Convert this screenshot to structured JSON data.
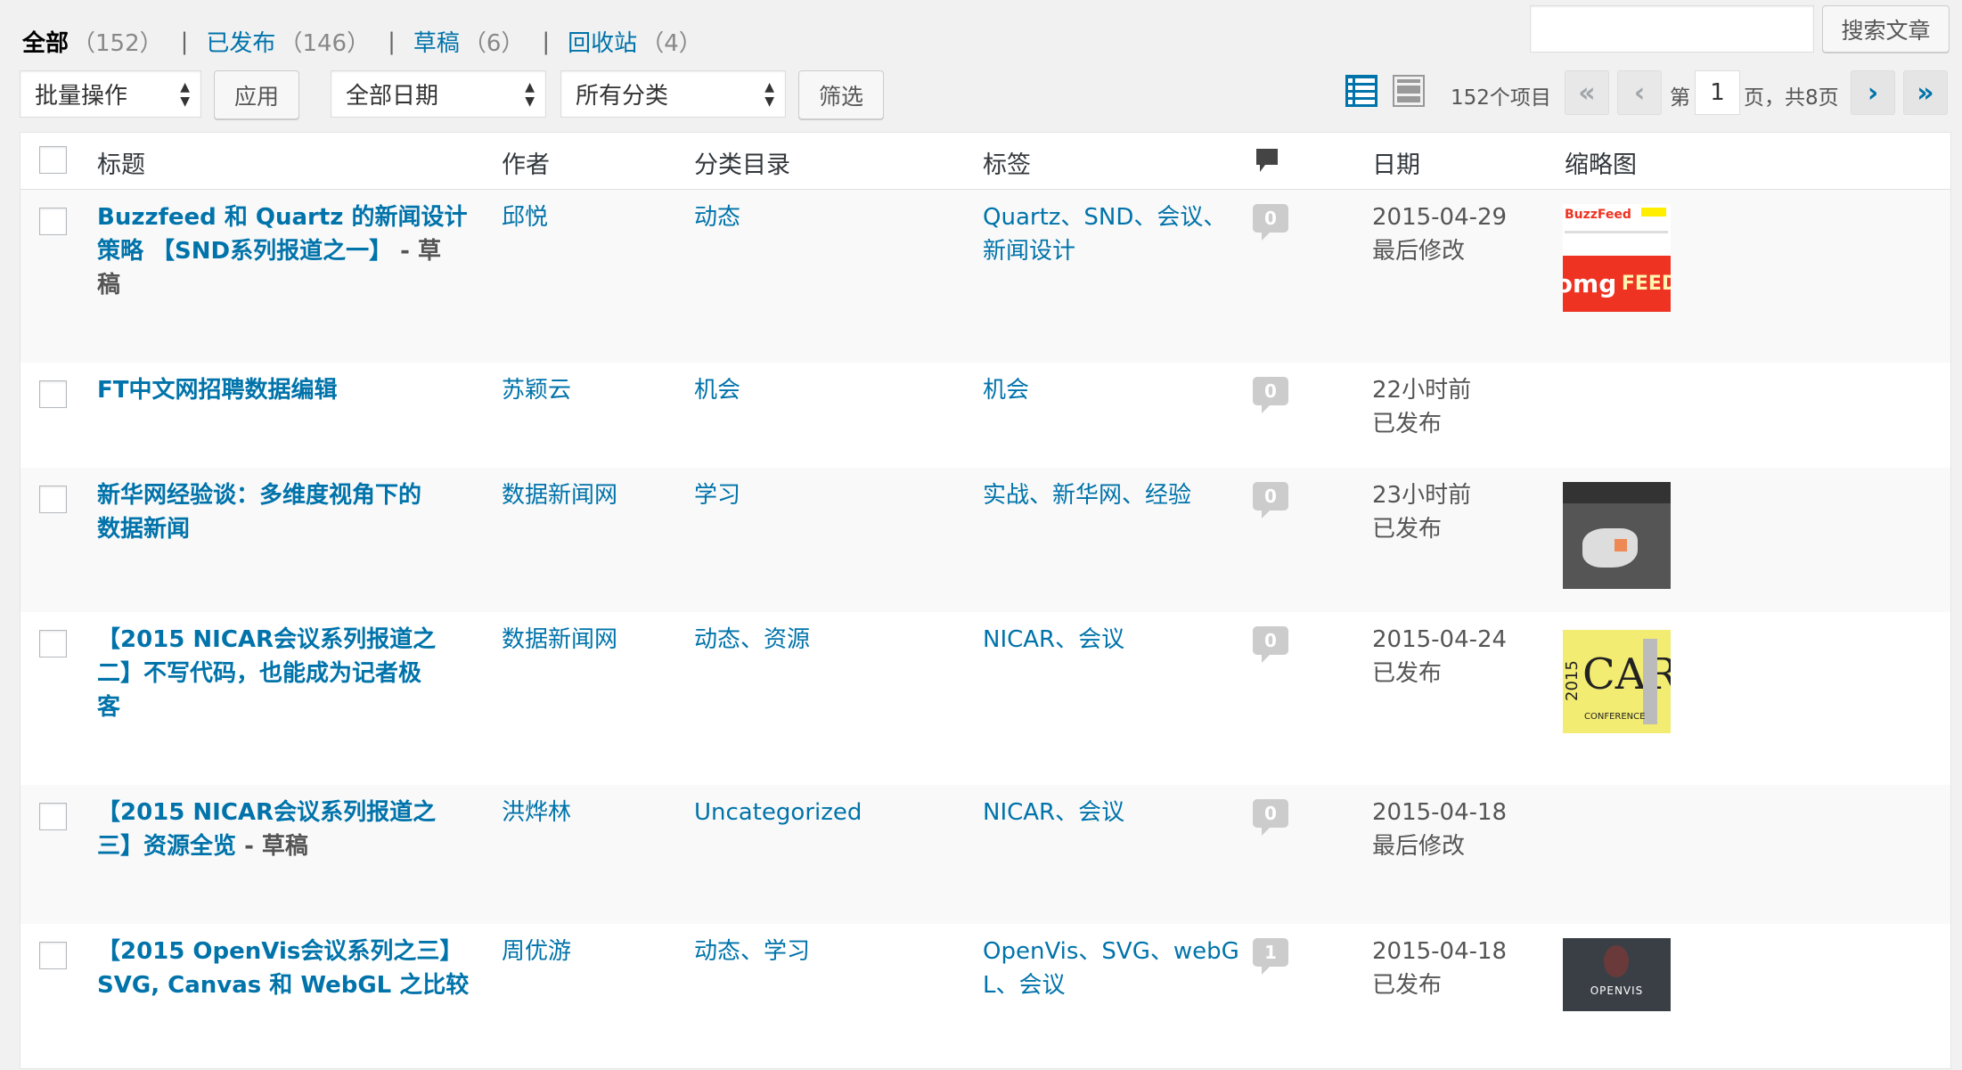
{
  "filters": {
    "all": {
      "label": "全部",
      "count": "（152）"
    },
    "published": {
      "label": "已发布",
      "count": "（146）"
    },
    "drafts": {
      "label": "草稿",
      "count": "（6）"
    },
    "trash": {
      "label": "回收站",
      "count": "（4）"
    },
    "separator": "|"
  },
  "search": {
    "input_value": "",
    "button_label": "搜索文章"
  },
  "tablenav": {
    "bulk_actions": "批量操作",
    "apply_label": "应用",
    "dates": "全部日期",
    "categories": "所有分类",
    "filter_label": "筛选",
    "items_count": "152个项目",
    "first_page": "«",
    "prev_page": "‹",
    "page_prefix": "第",
    "current_page": "1",
    "page_suffix": "页，共8页",
    "next_page": "›",
    "last_page": "»"
  },
  "columns": {
    "title": "标题",
    "author": "作者",
    "categories": "分类目录",
    "tags": "标签",
    "comments_icon": "comment-icon",
    "date": "日期",
    "thumbnail": "缩略图"
  },
  "posts": [
    {
      "title_lines": [
        "Buzzfeed 和 Quartz 的新闻设计",
        "策略 【SND系列报道之一】"
      ],
      "title_state": " - 草",
      "title_state_line2": "稿",
      "author": "邱悦",
      "categories": "动态",
      "tags_lines": [
        "Quartz、SND、会议、",
        "新闻设计"
      ],
      "comments": "0",
      "date": "2015-04-29",
      "status": "最后修改",
      "thumb": {
        "brand": "BuzzFeed",
        "text1": "omg",
        "text2": "FEED"
      }
    },
    {
      "title_lines": [
        "FT中文网招聘数据编辑"
      ],
      "author": "苏颖云",
      "categories": "机会",
      "tags_lines": [
        "机会"
      ],
      "comments": "0",
      "date": "22小时前",
      "status": "已发布"
    },
    {
      "title_lines": [
        "新华网经验谈：多维度视角下的",
        "数据新闻"
      ],
      "author": "数据新闻网",
      "categories": "学习",
      "tags_lines": [
        "实战、新华网、经验"
      ],
      "comments": "0",
      "date": "23小时前",
      "status": "已发布",
      "thumb": {}
    },
    {
      "title_lines": [
        "【2015 NICAR会议系列报道之",
        "二】不写代码，也能成为记者极",
        "客"
      ],
      "author": "数据新闻网",
      "categories": "动态、资源",
      "tags_lines": [
        "NICAR、会议"
      ],
      "comments": "0",
      "date": "2015-04-24",
      "status": "已发布",
      "thumb": {
        "text1": "CAR",
        "text2": "2015",
        "text3": "CONFERENCE"
      }
    },
    {
      "title_lines": [
        "【2015 NICAR会议系列报道之",
        "三】资源全览"
      ],
      "title_state": " - 草稿",
      "author": "洪烨林",
      "categories": "Uncategorized",
      "tags_lines": [
        "NICAR、会议"
      ],
      "comments": "0",
      "date": "2015-04-18",
      "status": "最后修改"
    },
    {
      "title_lines": [
        "【2015 OpenVis会议系列之三】",
        "SVG, Canvas 和 WebGL 之比较"
      ],
      "author": "周优游",
      "categories": "动态、学习",
      "tags_lines": [
        "OpenVis、SVG、webG",
        "L、会议"
      ],
      "comments": "1",
      "date": "2015-04-18",
      "status": "已发布",
      "thumb": {
        "text1": "OPENVIS"
      }
    }
  ]
}
